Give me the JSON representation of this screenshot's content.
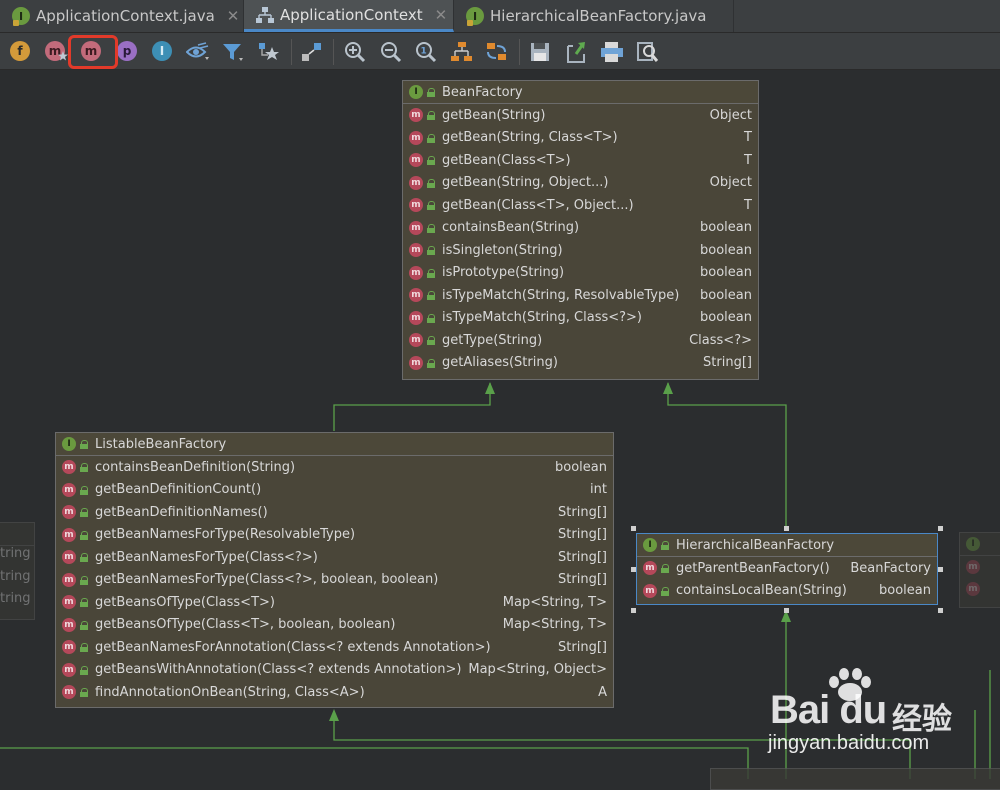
{
  "tabs": [
    {
      "label": "ApplicationContext.java",
      "icon": "interface-file-icon",
      "active": false
    },
    {
      "label": "ApplicationContext",
      "icon": "hierarchy-diagram-icon",
      "active": true
    },
    {
      "label": "HierarchicalBeanFactory.java",
      "icon": "interface-file-icon",
      "active": false
    }
  ],
  "toolbar": {
    "buttons": [
      {
        "name": "show-fields-button",
        "glyph": "f"
      },
      {
        "name": "show-constructors-button",
        "glyph": "m"
      },
      {
        "name": "show-methods-button",
        "glyph": "m"
      },
      {
        "name": "show-properties-button",
        "glyph": "p"
      },
      {
        "name": "show-inner-classes-button",
        "glyph": "I"
      }
    ]
  },
  "diagram": {
    "bean_factory": {
      "title": "BeanFactory",
      "methods": [
        {
          "name": "getBean(String)",
          "type": "Object"
        },
        {
          "name": "getBean(String, Class<T>)",
          "type": "T"
        },
        {
          "name": "getBean(Class<T>)",
          "type": "T"
        },
        {
          "name": "getBean(String, Object...)",
          "type": "Object"
        },
        {
          "name": "getBean(Class<T>, Object...)",
          "type": "T"
        },
        {
          "name": "containsBean(String)",
          "type": "boolean"
        },
        {
          "name": "isSingleton(String)",
          "type": "boolean"
        },
        {
          "name": "isPrototype(String)",
          "type": "boolean"
        },
        {
          "name": "isTypeMatch(String, ResolvableType)",
          "type": "boolean"
        },
        {
          "name": "isTypeMatch(String, Class<?>)",
          "type": "boolean"
        },
        {
          "name": "getType(String)",
          "type": "Class<?>"
        },
        {
          "name": "getAliases(String)",
          "type": "String[]"
        }
      ]
    },
    "listable_bean_factory": {
      "title": "ListableBeanFactory",
      "methods": [
        {
          "name": "containsBeanDefinition(String)",
          "type": "boolean"
        },
        {
          "name": "getBeanDefinitionCount()",
          "type": "int"
        },
        {
          "name": "getBeanDefinitionNames()",
          "type": "String[]"
        },
        {
          "name": "getBeanNamesForType(ResolvableType)",
          "type": "String[]"
        },
        {
          "name": "getBeanNamesForType(Class<?>)",
          "type": "String[]"
        },
        {
          "name": "getBeanNamesForType(Class<?>, boolean, boolean)",
          "type": "String[]"
        },
        {
          "name": "getBeansOfType(Class<T>)",
          "type": "Map<String, T>"
        },
        {
          "name": "getBeansOfType(Class<T>, boolean, boolean)",
          "type": "Map<String, T>"
        },
        {
          "name": "getBeanNamesForAnnotation(Class<? extends Annotation>)",
          "type": "String[]"
        },
        {
          "name": "getBeansWithAnnotation(Class<? extends Annotation>)",
          "type": "Map<String, Object>"
        },
        {
          "name": "findAnnotationOnBean(String, Class<A>)",
          "type": "A"
        }
      ]
    },
    "hierarchical_bean_factory": {
      "title": "HierarchicalBeanFactory",
      "methods": [
        {
          "name": "getParentBeanFactory()",
          "type": "BeanFactory"
        },
        {
          "name": "containsLocalBean(String)",
          "type": "boolean"
        }
      ]
    },
    "left_partial_rows": [
      "tring",
      "tring",
      "tring"
    ]
  },
  "watermark": {
    "logo": "Bai du",
    "cn": "经验",
    "url": "jingyan.baidu.com"
  }
}
